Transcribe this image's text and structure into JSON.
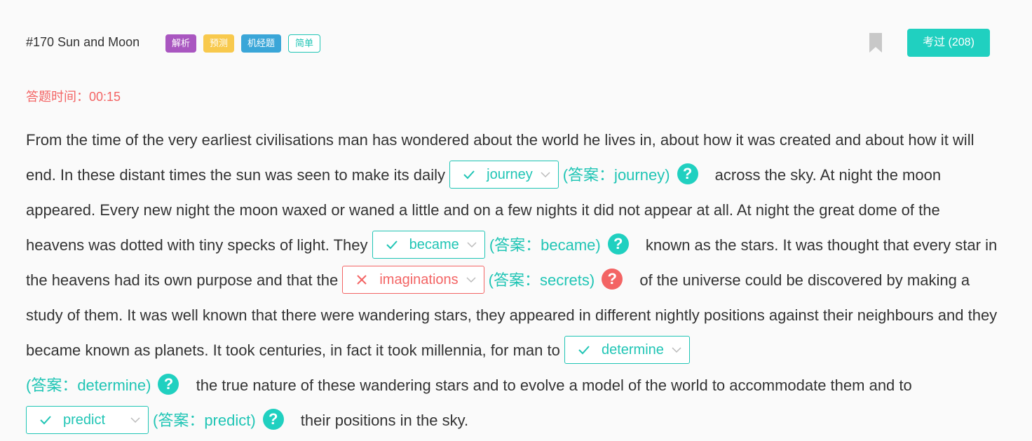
{
  "header": {
    "title": "#170 Sun and Moon",
    "tags": [
      "解析",
      "预测",
      "机经题",
      "简单"
    ],
    "exam_button": "考过 (208)"
  },
  "timer": {
    "label": "答题时间：",
    "value": "00:15"
  },
  "passage": {
    "t1": "From the time of the very earliest civilisations man has wondered about the world he lives in, about how it was created and about how it will end. In these distant times the sun was seen to make its daily",
    "b1": {
      "value": "journey",
      "answer": "(答案：journey)",
      "status": "correct"
    },
    "t2": " across the sky. At night the moon appeared. Every new night the moon waxed or waned a little and on a few nights it did not appear at all. At night the great dome of the heavens was dotted with tiny specks of light. They",
    "b2": {
      "value": "became",
      "answer": "(答案：became)",
      "status": "correct"
    },
    "t3": " known as the stars. It was thought that every star in the heavens had its own purpose and that the",
    "b3": {
      "value": "imaginations",
      "answer": "(答案：secrets)",
      "status": "wrong"
    },
    "t4": " of the universe could be discovered by making a study of them. It was well known that there were wandering stars, they appeared in different nightly positions against their neighbours and they became known as planets. It took centuries, in fact it took millennia, for man to",
    "b4": {
      "value": "determine",
      "answer": "(答案：determine)",
      "status": "correct"
    },
    "t5": " the true nature of these wandering stars and to evolve a model of the world to accommodate them and to",
    "b5": {
      "value": "predict",
      "answer": "(答案：predict)",
      "status": "correct"
    },
    "t6": " their positions in the sky.",
    "help_symbol": "?"
  },
  "colors": {
    "accent": "#20c5b5",
    "error": "#f36464",
    "tag_purple": "#a956c0",
    "tag_orange": "#f8c94d",
    "tag_blue": "#3aa6d8"
  }
}
